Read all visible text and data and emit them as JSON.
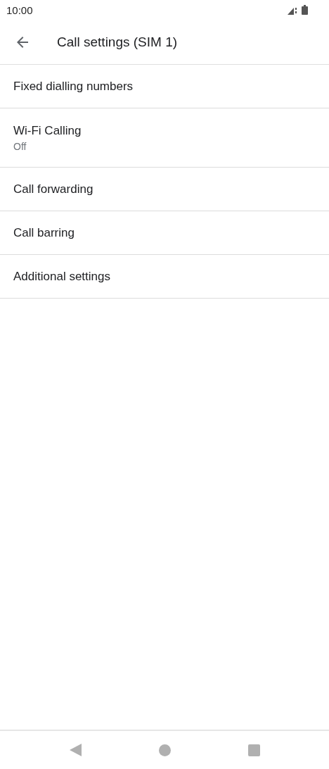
{
  "status_bar": {
    "time": "10:00"
  },
  "app_bar": {
    "title": "Call settings (SIM 1)"
  },
  "settings": [
    {
      "title": "Fixed dialling numbers"
    },
    {
      "title": "Wi-Fi Calling",
      "summary": "Off"
    },
    {
      "title": "Call forwarding"
    },
    {
      "title": "Call barring"
    },
    {
      "title": "Additional settings"
    }
  ]
}
